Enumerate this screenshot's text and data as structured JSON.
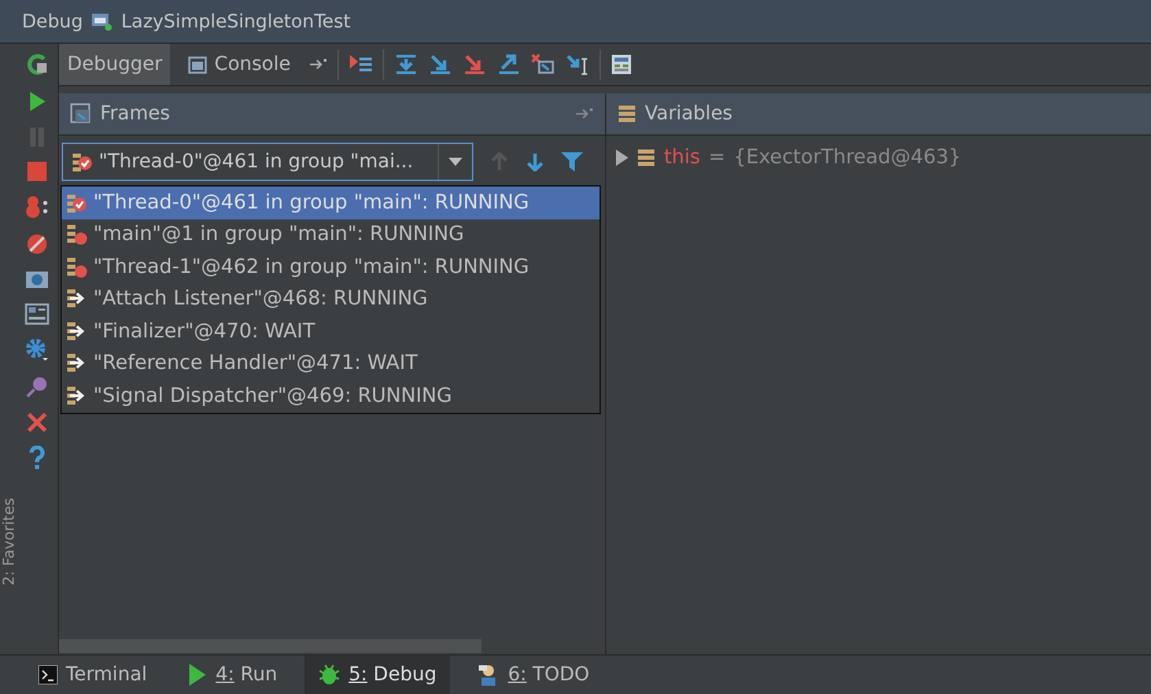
{
  "window": {
    "title": "Debug",
    "config": "LazySimpleSingletonTest"
  },
  "tabs": [
    {
      "label": "Debugger",
      "selected": true
    },
    {
      "label": "Console",
      "selected": false
    }
  ],
  "frames": {
    "title": "Frames",
    "thread_select": {
      "value": "\"Thread-0\"@461 in group \"mai..."
    },
    "threads": [
      {
        "label": "\"Thread-0\"@461 in group \"main\": RUNNING",
        "kind": "current",
        "selected": true
      },
      {
        "label": "\"main\"@1 in group \"main\": RUNNING",
        "kind": "suspended",
        "selected": false
      },
      {
        "label": "\"Thread-1\"@462 in group \"main\": RUNNING",
        "kind": "suspended",
        "selected": false
      },
      {
        "label": "\"Attach Listener\"@468: RUNNING",
        "kind": "running",
        "selected": false
      },
      {
        "label": "\"Finalizer\"@470: WAIT",
        "kind": "running",
        "selected": false
      },
      {
        "label": "\"Reference Handler\"@471: WAIT",
        "kind": "running",
        "selected": false
      },
      {
        "label": "\"Signal Dispatcher\"@469: RUNNING",
        "kind": "running",
        "selected": false
      }
    ]
  },
  "variables": {
    "title": "Variables",
    "items": [
      {
        "name": "this",
        "separator": "=",
        "value": "{ExectorThread@463}",
        "expanded": false
      }
    ]
  },
  "side_label": "2: Favorites",
  "bottom_tabs": [
    {
      "label": "Terminal",
      "kind": "terminal",
      "selected": false
    },
    {
      "label": "4: Run",
      "kind": "run",
      "selected": false
    },
    {
      "label": "5: Debug",
      "kind": "debug",
      "selected": true
    },
    {
      "label": "6: TODO",
      "kind": "todo",
      "selected": false
    }
  ]
}
